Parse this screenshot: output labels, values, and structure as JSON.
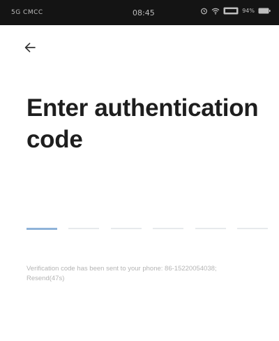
{
  "status_bar": {
    "carrier": "5G CMCC",
    "time": "08:45",
    "battery": "94%"
  },
  "header": {
    "back_icon": "arrow-left-icon"
  },
  "title": "Enter authentication code",
  "code_input": {
    "length": 6,
    "active_index": 0
  },
  "hint": {
    "text": "Verification code has been sent to your phone: 86-15220054038; ",
    "resend": "Resend(47s)"
  },
  "colors": {
    "status_bg": "#141414",
    "active_slot": "#8fb3d9",
    "inactive_slot": "#e7e9ec",
    "hint_text": "#b4b4b4"
  }
}
